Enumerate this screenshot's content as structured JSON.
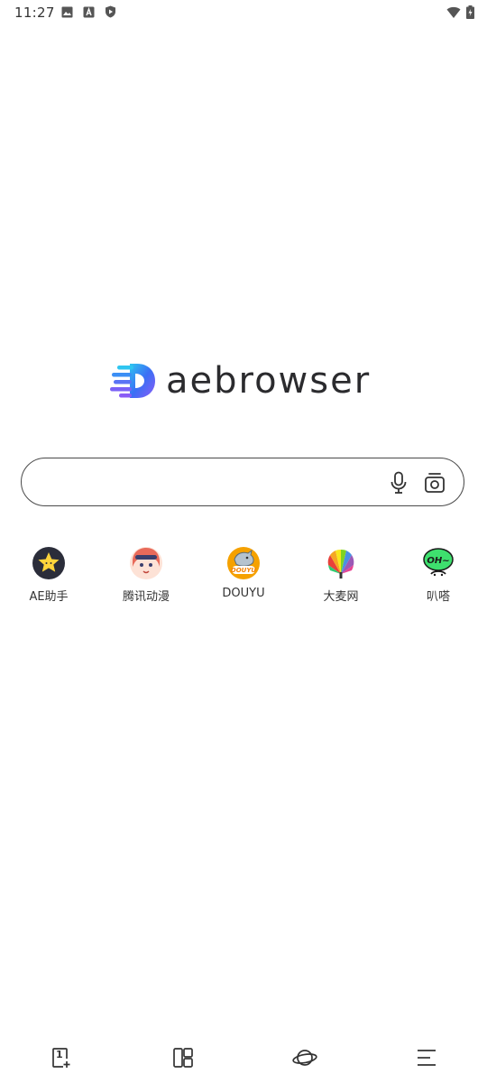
{
  "status_bar": {
    "time": "11:27",
    "left_icons": [
      "image-icon",
      "text-a-icon",
      "shield-play-icon"
    ],
    "right_icons": [
      "wifi-icon",
      "battery-icon"
    ]
  },
  "logo": {
    "text": "aebrowser",
    "mark_icon": "aebrowser-logo-icon",
    "colors": {
      "mark_blue": "#3b6ff5",
      "mark_purple": "#8a5cf6",
      "mark_cyan": "#2ec5f0",
      "text": "#2b2b2e"
    }
  },
  "search": {
    "value": "",
    "placeholder": "",
    "mic_icon": "microphone-icon",
    "camera_icon": "camera-scan-icon"
  },
  "shortcuts": [
    {
      "label": "AE助手",
      "icon": "star-avatar-icon"
    },
    {
      "label": "腾讯动漫",
      "icon": "anime-girl-icon"
    },
    {
      "label": "DOUYU",
      "icon": "douyu-shark-icon"
    },
    {
      "label": "大麦网",
      "icon": "damai-fan-icon"
    },
    {
      "label": "叭嗒",
      "icon": "bada-chat-icon"
    }
  ],
  "bottom_nav": {
    "tab_count": "1",
    "items": [
      "tabs-icon",
      "layout-icon",
      "planet-icon",
      "menu-icon"
    ]
  }
}
